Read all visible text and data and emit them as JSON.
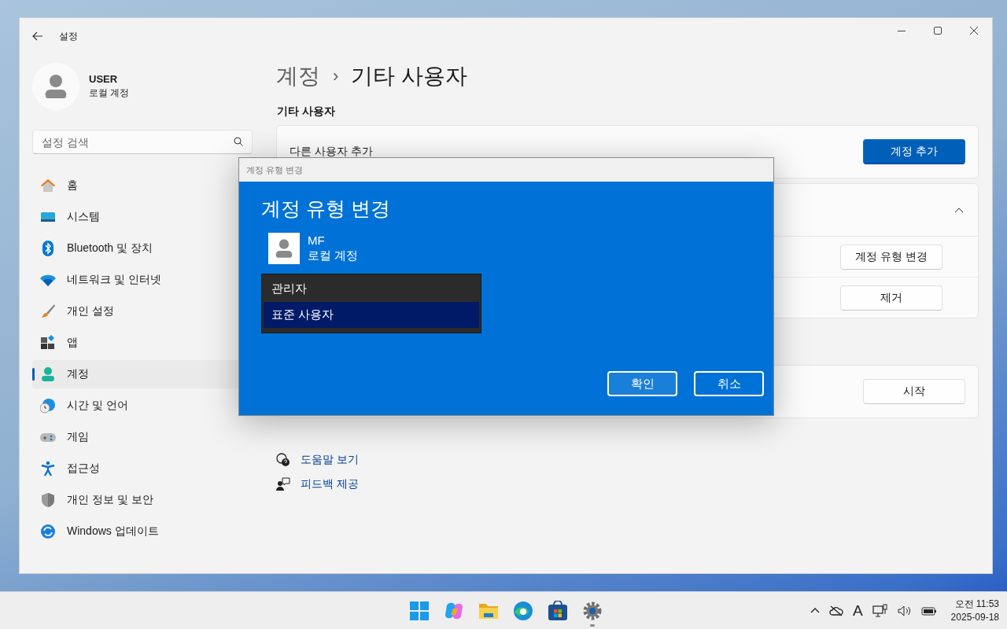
{
  "window": {
    "title": "설정"
  },
  "user": {
    "name": "USER",
    "type": "로컬 계정"
  },
  "search": {
    "placeholder": "설정 검색"
  },
  "nav": [
    {
      "kind": "home",
      "label": "홈",
      "selected": false
    },
    {
      "kind": "system",
      "label": "시스템",
      "selected": false
    },
    {
      "kind": "bluetooth",
      "label": "Bluetooth 및 장치",
      "selected": false
    },
    {
      "kind": "network",
      "label": "네트워크 및 인터넷",
      "selected": false
    },
    {
      "kind": "brush",
      "label": "개인 설정",
      "selected": false
    },
    {
      "kind": "apps",
      "label": "앱",
      "selected": false
    },
    {
      "kind": "account",
      "label": "계정",
      "selected": true
    },
    {
      "kind": "time",
      "label": "시간 및 언어",
      "selected": false
    },
    {
      "kind": "game",
      "label": "게임",
      "selected": false
    },
    {
      "kind": "access",
      "label": "접근성",
      "selected": false
    },
    {
      "kind": "shield",
      "label": "개인 정보 및 보안",
      "selected": false
    },
    {
      "kind": "update",
      "label": "Windows 업데이트",
      "selected": false
    }
  ],
  "breadcrumb": {
    "parent": "계정",
    "separator": "›",
    "current": "기타 사용자"
  },
  "section_title": "기타 사용자",
  "add_card": {
    "label": "다른 사용자 추가",
    "button": "계정 추가"
  },
  "user_card": {
    "expanded": true,
    "buttons": [
      "계정 유형 변경",
      "제거"
    ]
  },
  "kiosk_card": {
    "button": "시작"
  },
  "links": [
    {
      "kind": "help",
      "label": "도움말 보기"
    },
    {
      "kind": "feedback",
      "label": "피드백 제공"
    }
  ],
  "dialog": {
    "window_title": "계정 유형 변경",
    "heading": "계정 유형 변경",
    "user_name": "MF",
    "user_type": "로컬 계정",
    "options": [
      {
        "label": "관리자",
        "selected": false
      },
      {
        "label": "표준 사용자",
        "selected": true
      }
    ],
    "buttons": [
      {
        "label": "확인",
        "focused": true
      },
      {
        "label": "취소",
        "focused": false
      }
    ]
  },
  "taskbar": {
    "apps": [
      {
        "kind": "start",
        "active": false
      },
      {
        "kind": "copilot",
        "active": false
      },
      {
        "kind": "folder",
        "active": false
      },
      {
        "kind": "edge",
        "active": false
      },
      {
        "kind": "store",
        "active": false
      },
      {
        "kind": "settings",
        "active": true
      }
    ],
    "ime": "A",
    "time": "오전 11:53",
    "date": "2025-09-18"
  }
}
